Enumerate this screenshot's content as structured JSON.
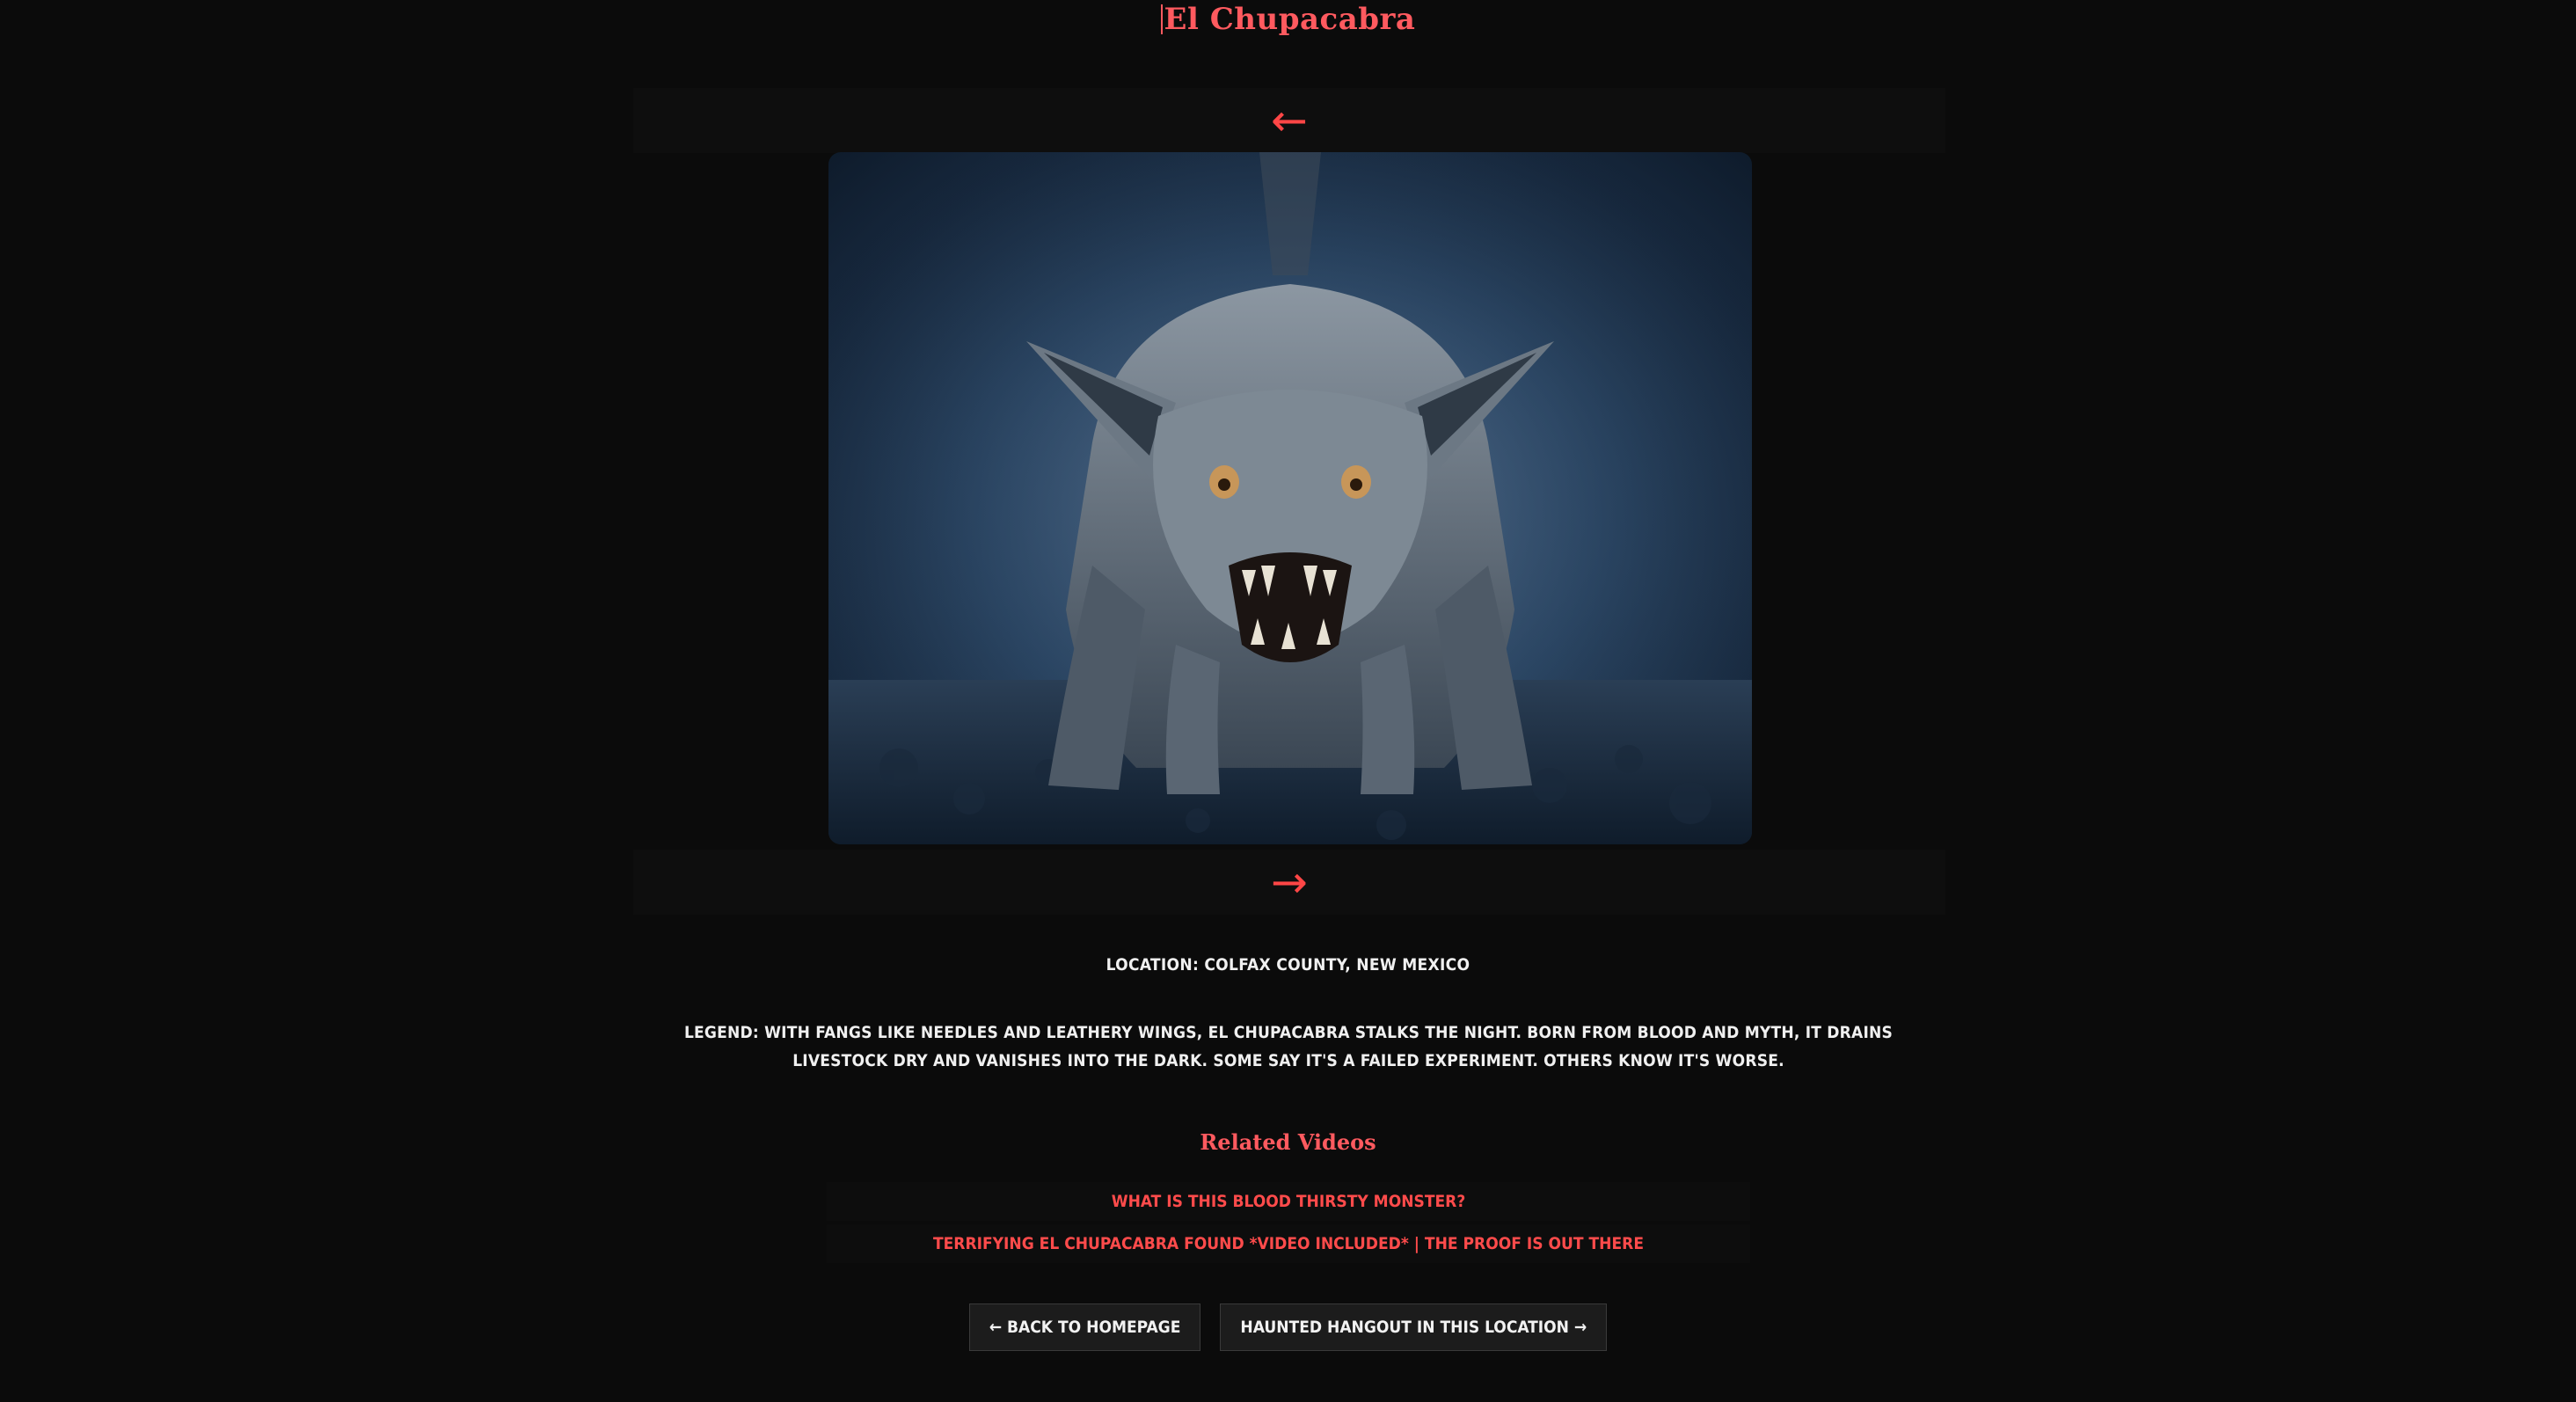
{
  "page": {
    "title": "El Chupacabra"
  },
  "carousel": {
    "prev_arrow": "←",
    "next_arrow": "→",
    "image_alt": "El Chupacabra creature in misty blue forest"
  },
  "details": {
    "location": "Location: Colfax County, New Mexico",
    "legend": "Legend: With fangs like needles and leathery wings, El Chupacabra stalks the night. Born from blood and myth, it drains livestock dry and vanishes into the dark. Some say it's a failed experiment. Others know it's worse."
  },
  "related": {
    "heading": "Related Videos",
    "videos": [
      {
        "label": "What is this blood thirsty monster?"
      },
      {
        "label": "TERRIFYING EL CHUPACABRA FOUND *VIDEO INCLUDED* | The Proof is Out There"
      }
    ]
  },
  "nav": {
    "back_label": "← Back to Homepage",
    "hangout_label": "Haunted Hangout in this Location →"
  },
  "colors": {
    "background": "#0b0b0b",
    "accent": "#ff5a5f",
    "text": "#f0f0f0"
  }
}
